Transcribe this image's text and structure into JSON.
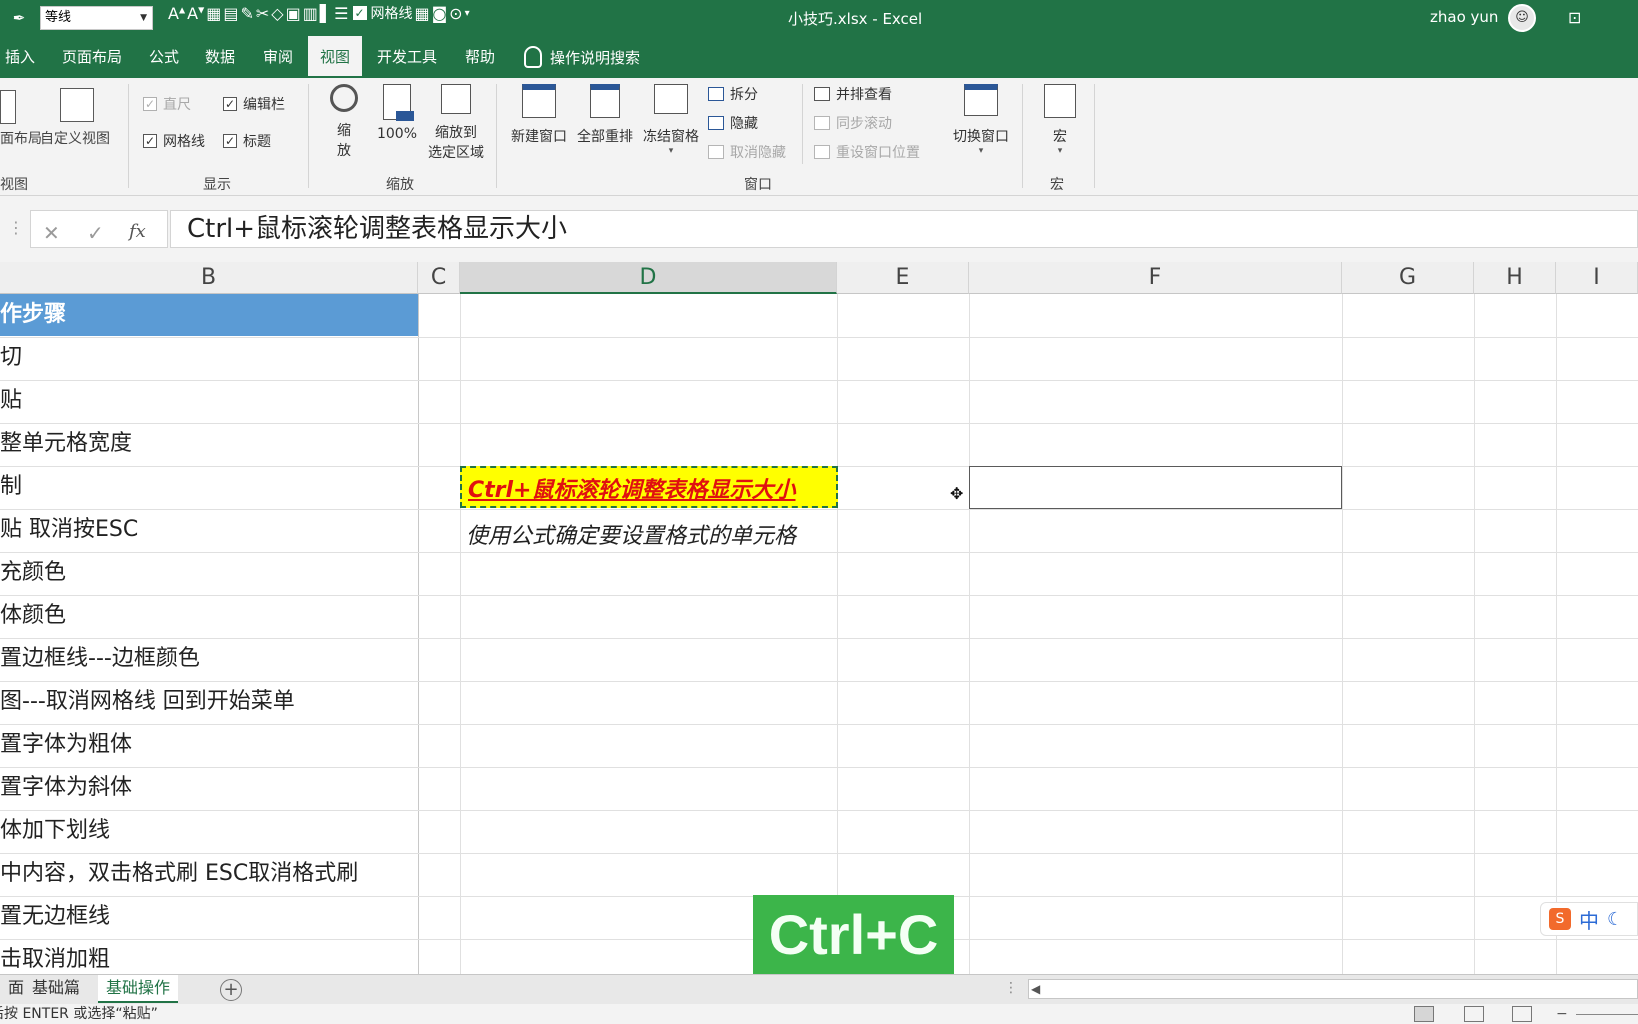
{
  "titlebar": {
    "font_name": "等线",
    "gridlines_label": "网格线",
    "title": "小技巧.xlsx  -  Excel",
    "user": "zhao yun"
  },
  "tabs": [
    {
      "label": "插入"
    },
    {
      "label": "页面布局"
    },
    {
      "label": "公式"
    },
    {
      "label": "数据"
    },
    {
      "label": "审阅"
    },
    {
      "label": "视图",
      "active": true
    },
    {
      "label": "开发工具"
    },
    {
      "label": "帮助"
    }
  ],
  "tell_me": "操作说明搜索",
  "ribbon": {
    "views": {
      "page_layout": "面布局",
      "custom_view": "自定义视图",
      "group": "视图"
    },
    "show": {
      "ruler": "直尺",
      "formula_bar": "编辑栏",
      "gridlines": "网格线",
      "headings": "标题",
      "group": "显示"
    },
    "zoom": {
      "zoom": "缩放",
      "zoom_line1": "缩",
      "zoom_line2": "放",
      "hundred": "100%",
      "to_selection_1": "缩放到",
      "to_selection_2": "选定区域",
      "group": "缩放"
    },
    "window": {
      "new_window": "新建窗口",
      "arrange_all": "全部重排",
      "freeze_panes": "冻结窗格",
      "split": "拆分",
      "hide": "隐藏",
      "unhide": "取消隐藏",
      "side_by_side": "并排查看",
      "sync_scroll": "同步滚动",
      "reset_position": "重设窗口位置",
      "switch_windows": "切换窗口",
      "group": "窗口"
    },
    "macros": {
      "macros": "宏",
      "group": "宏"
    }
  },
  "formula_bar": {
    "cancel_icon": "close-icon",
    "enter_icon": "check-icon",
    "fx": "fx",
    "value": "Ctrl+鼠标滚轮调整表格显示大小"
  },
  "columns": [
    "B",
    "C",
    "D",
    "E",
    "F",
    "G",
    "H",
    "I"
  ],
  "column_b": [
    "作步骤",
    "切",
    "贴",
    "整单元格宽度",
    "制",
    "贴  取消按ESC",
    "充颜色",
    "体颜色",
    "置边框线---边框颜色",
    "图---取消网格线  回到开始菜单",
    "置字体为粗体",
    "置字体为斜体",
    "体加下划线",
    "中内容，双击格式刷   ESC取消格式刷",
    "置无边框线",
    "击取消加粗"
  ],
  "d_highlight": "Ctrl+鼠标滚轮调整表格显示大小",
  "d_sub": "使用公式确定要设置格式的单元格",
  "overlay_key": "Ctrl+C",
  "ime": {
    "lang": "中"
  },
  "sheet_tabs": [
    {
      "label": "面"
    },
    {
      "label": "基础篇"
    },
    {
      "label": "基础操作",
      "active": true
    }
  ],
  "status_text": "选择目标区域，然后按 ENTER 或选择“粘贴”",
  "colors": {
    "excel_green": "#217346",
    "header_blue": "#5b9bd5",
    "highlight_yellow": "#ffff00",
    "overlay_green": "#3cb54a"
  }
}
